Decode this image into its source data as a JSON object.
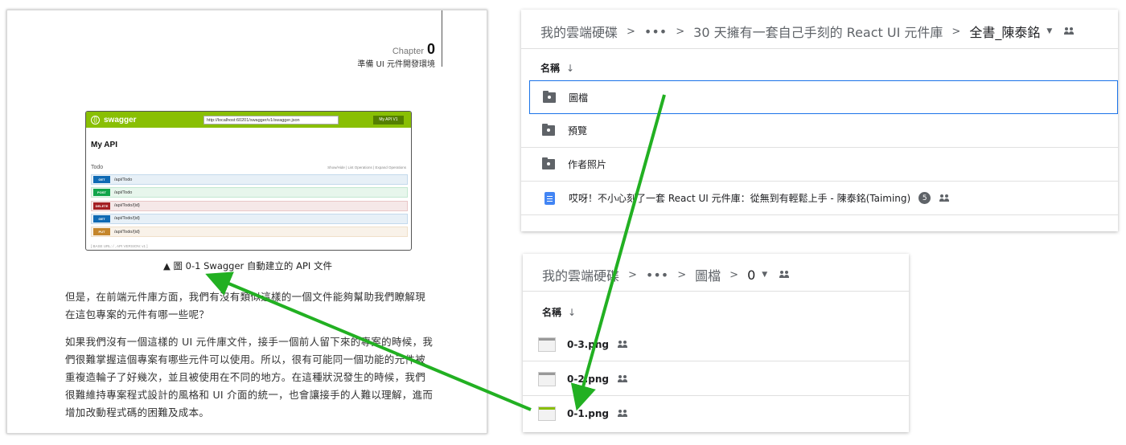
{
  "book": {
    "chapter_label": "Chapter",
    "chapter_number": "0",
    "chapter_title": "準備 UI 元件開發環境",
    "caption": "▲ 圖 0-1  Swagger 自動建立的 API 文件",
    "para1": "但是，在前端元件庫方面，我們有沒有類似這樣的一個文件能夠幫助我們瞭解現在這包專案的元件有哪一些呢？",
    "para2": "如果我們沒有一個這樣的 UI 元件庫文件，接手一個前人留下來的專案的時候，我們很難掌握這個專案有哪些元件可以使用。所以，很有可能同一個功能的元件被重複造輪子了好幾次，並且被使用在不同的地方。在這種狀況發生的時候，我們很難維持專案程式設計的風格和 UI 介面的統一，也會讓接手的人難以理解，進而增加改動程式碼的困難及成本。",
    "swagger": {
      "brand": "swagger",
      "url": "http://localhost:60201/swagger/v1/swagger.json",
      "select": "My API V1",
      "title": "My API",
      "section": "Todo",
      "links": "Show/Hide  |  List Operations  |  Expand Operations",
      "ops": [
        {
          "method": "GET",
          "path": "/api/Todo",
          "color": "#0f6ab4",
          "bg": "#e7f0f7",
          "border": "#c3d9ec"
        },
        {
          "method": "POST",
          "path": "/api/Todo",
          "color": "#10a54a",
          "bg": "#e7f6ec",
          "border": "#c3e8d1"
        },
        {
          "method": "DELETE",
          "path": "/api/Todo/{id}",
          "color": "#a41e22",
          "bg": "#f5e8e8",
          "border": "#e8c6c7"
        },
        {
          "method": "GET",
          "path": "/api/Todo/{id}",
          "color": "#0f6ab4",
          "bg": "#e7f0f7",
          "border": "#c3d9ec"
        },
        {
          "method": "PUT",
          "path": "/api/Todo/{id}",
          "color": "#c5862b",
          "bg": "#f9f2e9",
          "border": "#f0e0ca"
        }
      ],
      "footer": "[ BASE URL: / , API VERSION: v1 ]"
    }
  },
  "drive1": {
    "crumbs": [
      "我的雲端硬碟",
      "•••",
      "30 天擁有一套自己手刻的 React UI 元件庫"
    ],
    "current": "全書_陳泰銘",
    "col_name": "名稱",
    "sort_icon": "↓",
    "items": [
      {
        "name": "圖檔",
        "type": "shared-folder",
        "selected": true
      },
      {
        "name": "預覽",
        "type": "shared-folder"
      },
      {
        "name": "作者照片",
        "type": "shared-folder"
      },
      {
        "name": "哎呀！不小心刻了一套 React UI 元件庫：從無到有輕鬆上手 - 陳泰銘(Taiming)",
        "type": "doc",
        "badge": "5",
        "shared": true
      }
    ]
  },
  "drive2": {
    "crumbs": [
      "我的雲端硬碟",
      "•••",
      "圖檔"
    ],
    "current": "0",
    "col_name": "名稱",
    "sort_icon": "↓",
    "items": [
      {
        "name": "0-3.png"
      },
      {
        "name": "0-2.png"
      },
      {
        "name": "0-1.png"
      }
    ]
  },
  "colors": {
    "arrow": "#22b022",
    "selection": "#1a73e8",
    "swagger_green": "#89bf04"
  }
}
